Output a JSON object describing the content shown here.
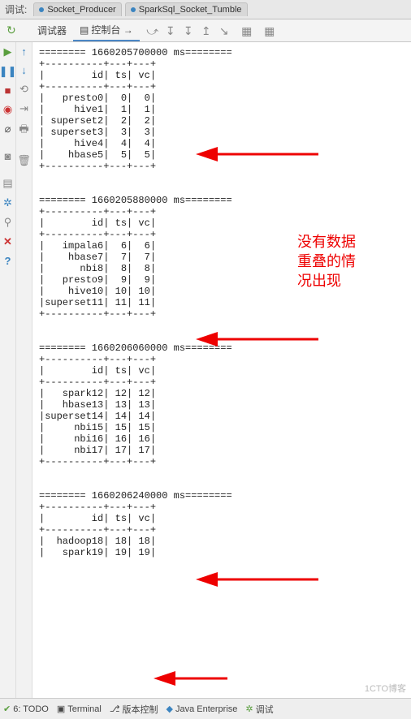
{
  "topTabs": {
    "label": "调试:",
    "file1": "Socket_Producer",
    "file2": "SparkSql_Socket_Tumble"
  },
  "innerTabs": {
    "debugger": "调试器",
    "console": "控制台"
  },
  "bottom": {
    "todo": "6: TODO",
    "terminal": "Terminal",
    "vcs": "版本控制",
    "jee": "Java Enterprise",
    "debug": "调试"
  },
  "annotation": {
    "l1": "没有数据",
    "l2": "重叠的情",
    "l3": "况出现"
  },
  "watermark": "1CTO博客",
  "chart_data": {
    "type": "table",
    "blocks": [
      {
        "header": "1660205700000 ms",
        "columns": [
          "id",
          "ts",
          "vc"
        ],
        "rows": [
          [
            "presto0",
            "0",
            "0"
          ],
          [
            "hive1",
            "1",
            "1"
          ],
          [
            "superset2",
            "2",
            "2"
          ],
          [
            "superset3",
            "3",
            "3"
          ],
          [
            "hive4",
            "4",
            "4"
          ],
          [
            "hbase5",
            "5",
            "5"
          ]
        ]
      },
      {
        "header": "1660205880000 ms",
        "columns": [
          "id",
          "ts",
          "vc"
        ],
        "rows": [
          [
            "impala6",
            "6",
            "6"
          ],
          [
            "hbase7",
            "7",
            "7"
          ],
          [
            "nbi8",
            "8",
            "8"
          ],
          [
            "presto9",
            "9",
            "9"
          ],
          [
            "hive10",
            "10",
            "10"
          ],
          [
            "superset11",
            "11",
            "11"
          ]
        ]
      },
      {
        "header": "1660206060000 ms",
        "columns": [
          "id",
          "ts",
          "vc"
        ],
        "rows": [
          [
            "spark12",
            "12",
            "12"
          ],
          [
            "hbase13",
            "13",
            "13"
          ],
          [
            "superset14",
            "14",
            "14"
          ],
          [
            "nbi15",
            "15",
            "15"
          ],
          [
            "nbi16",
            "16",
            "16"
          ],
          [
            "nbi17",
            "17",
            "17"
          ]
        ]
      },
      {
        "header": "1660206240000 ms",
        "columns": [
          "id",
          "ts",
          "vc"
        ],
        "rows": [
          [
            "hadoop18",
            "18",
            "18"
          ],
          [
            "spark19",
            "19",
            "19"
          ]
        ]
      }
    ]
  }
}
